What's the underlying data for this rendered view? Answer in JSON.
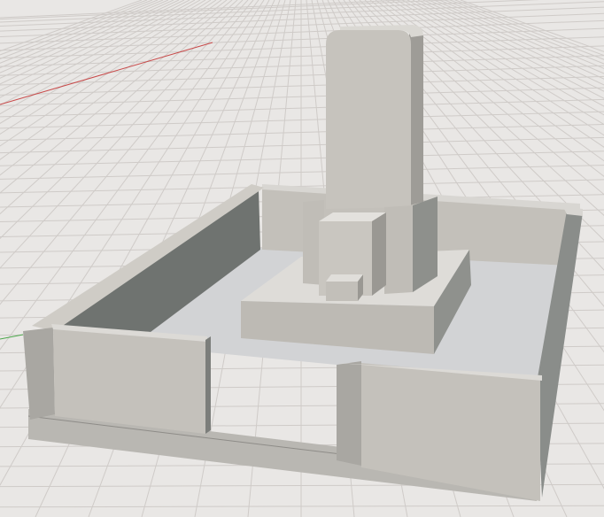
{
  "scene": {
    "subject": "grave-monument",
    "colors": {
      "background": "#e9e7e5",
      "grid": "#cfcbc8",
      "axis_x": "#c84a4a",
      "axis_y": "#4ca84c",
      "stone_light": "#c9c6c0",
      "stone_mid": "#aeaba5",
      "stone_dark": "#6e726f",
      "floor": "#d3d4d6"
    }
  }
}
